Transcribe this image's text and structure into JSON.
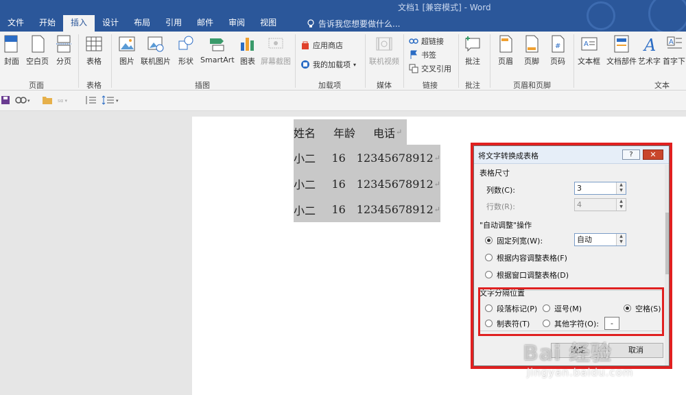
{
  "window": {
    "title": "文档1 [兼容模式] - Word"
  },
  "tabs": [
    "文件",
    "开始",
    "插入",
    "设计",
    "布局",
    "引用",
    "邮件",
    "审阅",
    "视图"
  ],
  "tell_me": "告诉我您想要做什么...",
  "ribbon": {
    "pages": {
      "cover": "封面",
      "blank": "空白页",
      "break": "分页",
      "label": "页面"
    },
    "tables": {
      "table": "表格",
      "label": "表格"
    },
    "illustrations": {
      "picture": "图片",
      "online_picture": "联机图片",
      "shapes": "形状",
      "smartart": "SmartArt",
      "chart": "图表",
      "screenshot": "屏幕截图",
      "label": "插图"
    },
    "addins": {
      "store": "应用商店",
      "my_addins": "我的加载项",
      "label": "加载项"
    },
    "media": {
      "online_video": "联机视频",
      "label": "媒体"
    },
    "links": {
      "hyperlink": "超链接",
      "bookmark": "书签",
      "cross_ref": "交叉引用",
      "label": "链接"
    },
    "comments": {
      "comment": "批注",
      "label": "批注"
    },
    "header_footer": {
      "header": "页眉",
      "footer": "页脚",
      "page_number": "页码",
      "label": "页眉和页脚"
    },
    "text": {
      "textbox": "文本框",
      "quick_parts": "文档部件",
      "wordart": "艺术字",
      "dropcap": "首字下",
      "label": "文本"
    }
  },
  "document": {
    "rows": [
      [
        "姓名",
        "年龄",
        "电话"
      ],
      [
        "小二",
        "16",
        "12345678912"
      ],
      [
        "小二",
        "16",
        "12345678912"
      ],
      [
        "小二",
        "16",
        "12345678912"
      ]
    ],
    "para_mark": "↵"
  },
  "dialog": {
    "title": "将文字转换成表格",
    "help": "?",
    "close": "✕",
    "table_size": "表格尺寸",
    "columns_label": "列数(C):",
    "columns_value": "3",
    "rows_label": "行数(R):",
    "rows_value": "4",
    "autofit_label": "\"自动调整\"操作",
    "fixed_width_label": "固定列宽(W):",
    "fixed_width_value": "自动",
    "fit_content": "根据内容调整表格(F)",
    "fit_window": "根据窗口调整表格(D)",
    "separator_label": "文字分隔位置",
    "paragraph": "段落标记(P)",
    "comma": "逗号(M)",
    "space": "空格(S)",
    "tab": "制表符(T)",
    "other": "其他字符(O):",
    "other_value": "-",
    "ok": "确定",
    "cancel": "取消"
  },
  "watermark": {
    "logo": "Bai  经验",
    "url": "jingyan.baidu.com"
  },
  "colors": {
    "accent": "#2b579a",
    "highlight": "#e02020"
  }
}
